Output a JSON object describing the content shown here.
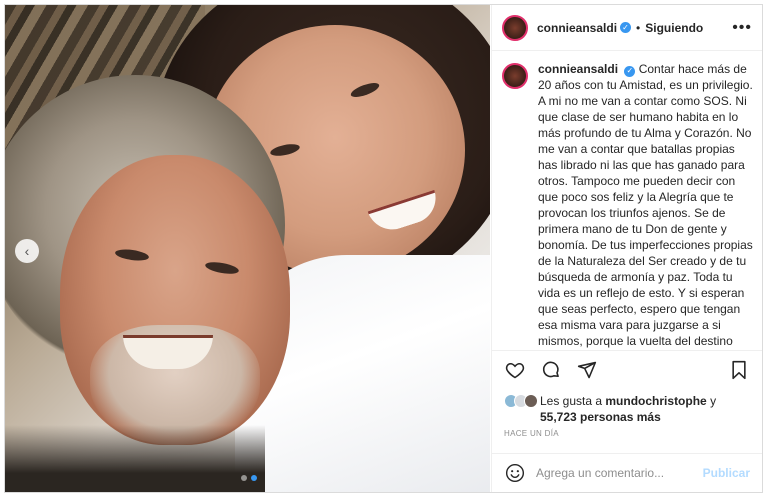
{
  "post": {
    "username": "connieansaldi",
    "follow_status": "Siguiendo",
    "separator": "•",
    "verified_mark": "✓",
    "more_icon": "•••",
    "caption": "Contar hace más de 20 años con tu Amistad, es un privilegio. A mi no me van a contar como SOS. Ni que clase de ser humano habita en lo más profundo de tu Alma y Corazón. No me van a contar que batallas propias has librado ni las que has ganado para otros. Tampoco me pueden decir con que poco sos feliz y la Alegría que te provocan los triunfos ajenos. Se de primera mano de tu Don de gente y bonomía. De tus imperfecciones propias de la Naturaleza del Ser creado y de tu búsqueda de armonía y paz. Toda tu vida es un reflejo de esto. Y si esperan que seas perfecto, espero que tengan esa misma vara para juzgarse a si mismos, porque la vuelta del destino suele cobrarle caro a los que"
  },
  "likes": {
    "prefix": "Les gusta a",
    "user": "mundochristophe",
    "connector": "y",
    "count": "55,723 personas más"
  },
  "timestamp": "HACE UN DÍA",
  "comment": {
    "placeholder": "Agrega un comentario...",
    "publish_label": "Publicar"
  },
  "carousel": {
    "prev_glyph": "‹",
    "total_slides": 2,
    "active_slide": 2
  },
  "colors": {
    "verified": "#3897f0",
    "publish_disabled": "#b3dbff",
    "active_dot": "#3897f0"
  },
  "icons": [
    "heart-icon",
    "comment-icon",
    "share-icon",
    "bookmark-icon",
    "emoji-icon",
    "chevron-left-icon",
    "more-icon",
    "verified-icon"
  ]
}
